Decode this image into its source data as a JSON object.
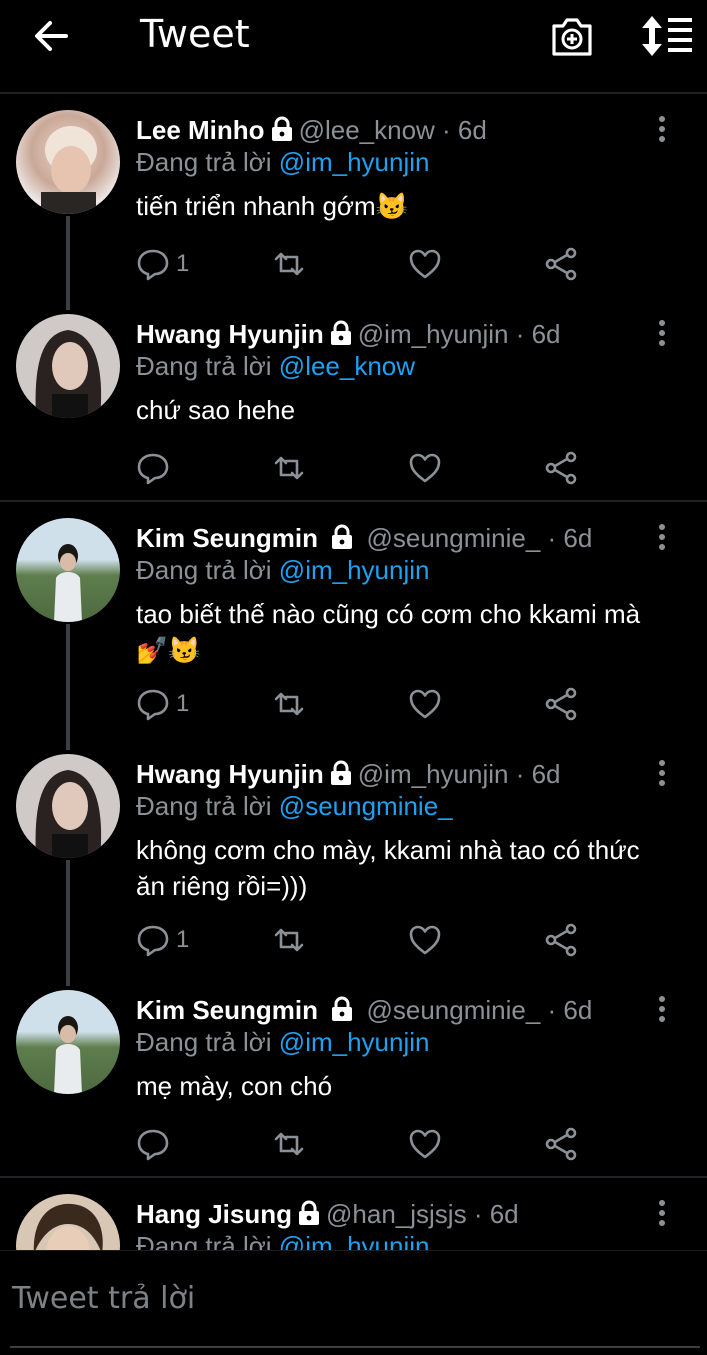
{
  "header": {
    "title": "Tweet"
  },
  "tweets": [
    {
      "name": "Lee Minho",
      "handle": "@lee_know",
      "time": "· 6d",
      "replying_label": "Đang trả lời",
      "replying_to": "@im_hyunjin",
      "text": "tiến triển nhanh gớm😼",
      "reply_count": "1"
    },
    {
      "name": "Hwang Hyunjin",
      "handle": "@im_hyunjin",
      "time": "· 6d",
      "replying_label": "Đang trả lời",
      "replying_to": "@lee_know",
      "text": "chứ sao hehe",
      "reply_count": ""
    },
    {
      "name": "Kim Seungmin",
      "handle": "@seungminie_",
      "time": "· 6d",
      "replying_label": "Đang trả lời",
      "replying_to": "@im_hyunjin",
      "text": "tao biết thế nào cũng có cơm cho kkami mà💅😼",
      "reply_count": "1"
    },
    {
      "name": "Hwang Hyunjin",
      "handle": "@im_hyunjin",
      "time": "· 6d",
      "replying_label": "Đang trả lời",
      "replying_to": "@seungminie_",
      "text": "không cơm cho mày, kkami nhà tao có thức ăn riêng rồi=)))",
      "reply_count": "1"
    },
    {
      "name": "Kim Seungmin",
      "handle": "@seungminie_",
      "time": "· 6d",
      "replying_label": "Đang trả lời",
      "replying_to": "@im_hyunjin",
      "text": "mẹ mày, con chó",
      "reply_count": ""
    },
    {
      "name": "Hang Jisung",
      "handle": "@han_jsjsjs",
      "time": "· 6d",
      "replying_label": "Đang trả lời",
      "replying_to": "@im_hyunjin",
      "text": "",
      "reply_count": ""
    }
  ],
  "composer": {
    "placeholder": "Tweet trả lời"
  },
  "colors": {
    "background": "#000000",
    "mention": "#1da1f2",
    "muted": "#8b9196"
  }
}
